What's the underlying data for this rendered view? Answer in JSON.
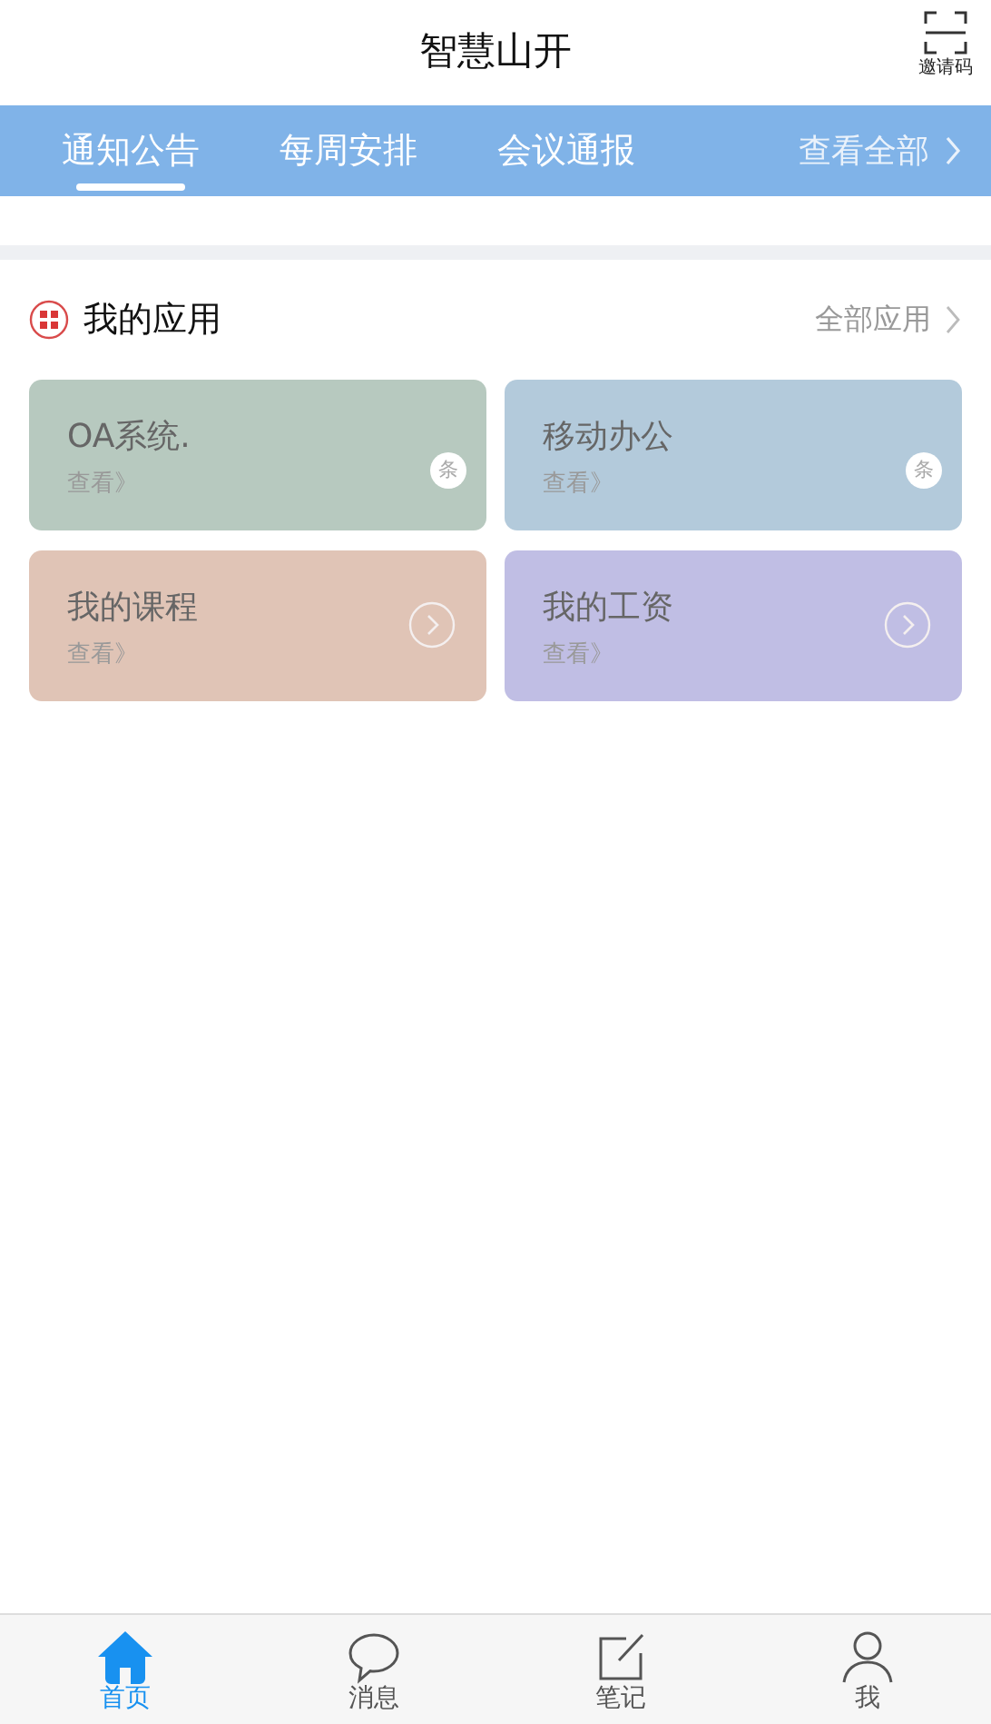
{
  "header": {
    "title": "智慧山开",
    "invite_label": "邀请码"
  },
  "tabs": [
    {
      "label": "通知公告",
      "selected": true
    },
    {
      "label": "每周安排",
      "selected": false
    },
    {
      "label": "会议通报",
      "selected": false
    }
  ],
  "view_all": "查看全部",
  "apps_section": {
    "title": "我的应用",
    "more": "全部应用"
  },
  "apps": [
    {
      "title": "OA系统.",
      "sub": "查看》",
      "color": "#b7c9bf",
      "kind": "badge",
      "badge": "条"
    },
    {
      "title": "移动办公",
      "sub": "查看》",
      "color": "#b3cadb",
      "kind": "badge",
      "badge": "条"
    },
    {
      "title": "我的课程",
      "sub": "查看》",
      "color": "#e0c4b6",
      "kind": "arrow"
    },
    {
      "title": "我的工资",
      "sub": "查看》",
      "color": "#c0bee4",
      "kind": "arrow"
    }
  ],
  "bottom_nav": [
    {
      "label": "首页",
      "kind": "home",
      "selected": true
    },
    {
      "label": "消息",
      "kind": "chat",
      "selected": false
    },
    {
      "label": "笔记",
      "kind": "note",
      "selected": false
    },
    {
      "label": "我",
      "kind": "person",
      "selected": false
    }
  ]
}
